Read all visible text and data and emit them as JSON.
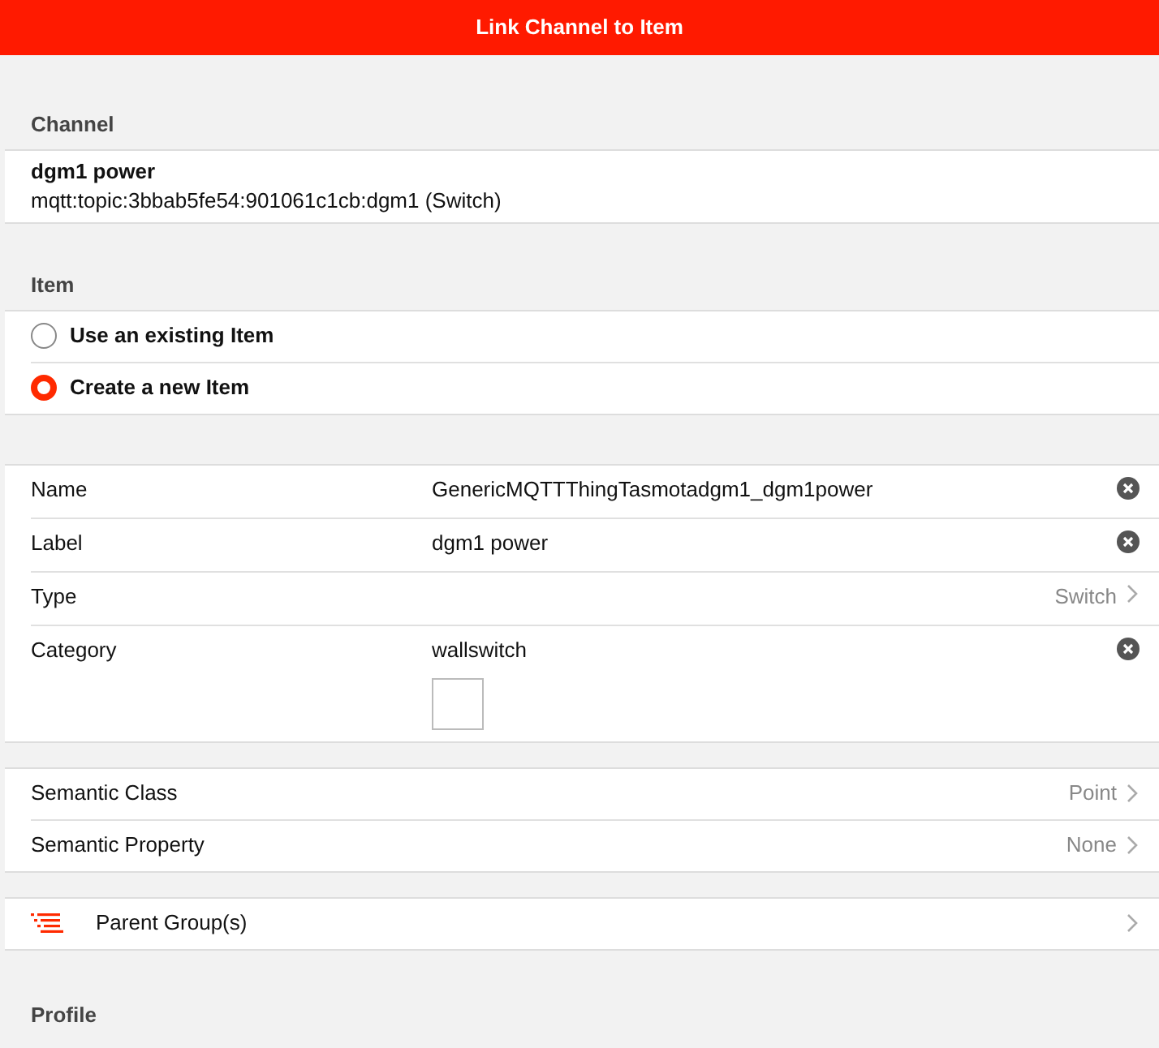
{
  "window": {
    "title": "Link Channel to Item"
  },
  "channel": {
    "heading": "Channel",
    "name": "dgm1 power",
    "uid": "mqtt:topic:3bbab5fe54:901061c1cb:dgm1 (Switch)"
  },
  "item": {
    "heading": "Item",
    "options": [
      {
        "label": "Use an existing Item",
        "selected": false
      },
      {
        "label": "Create a new Item",
        "selected": true
      }
    ]
  },
  "fields": [
    {
      "kind": "input",
      "label": "Name",
      "value": "GenericMQTTThingTasmotadgm1_dgm1power"
    },
    {
      "kind": "input",
      "label": "Label",
      "value": "dgm1 power"
    },
    {
      "kind": "select",
      "label": "Type",
      "value": "Switch"
    },
    {
      "kind": "category",
      "label": "Category",
      "value": "wallswitch"
    }
  ],
  "semantics": [
    {
      "label": "Semantic Class",
      "value": "Point"
    },
    {
      "label": "Semantic Property",
      "value": "None"
    }
  ],
  "parent_groups": {
    "label": "Parent Group(s)"
  },
  "profile": {
    "heading": "Profile"
  }
}
